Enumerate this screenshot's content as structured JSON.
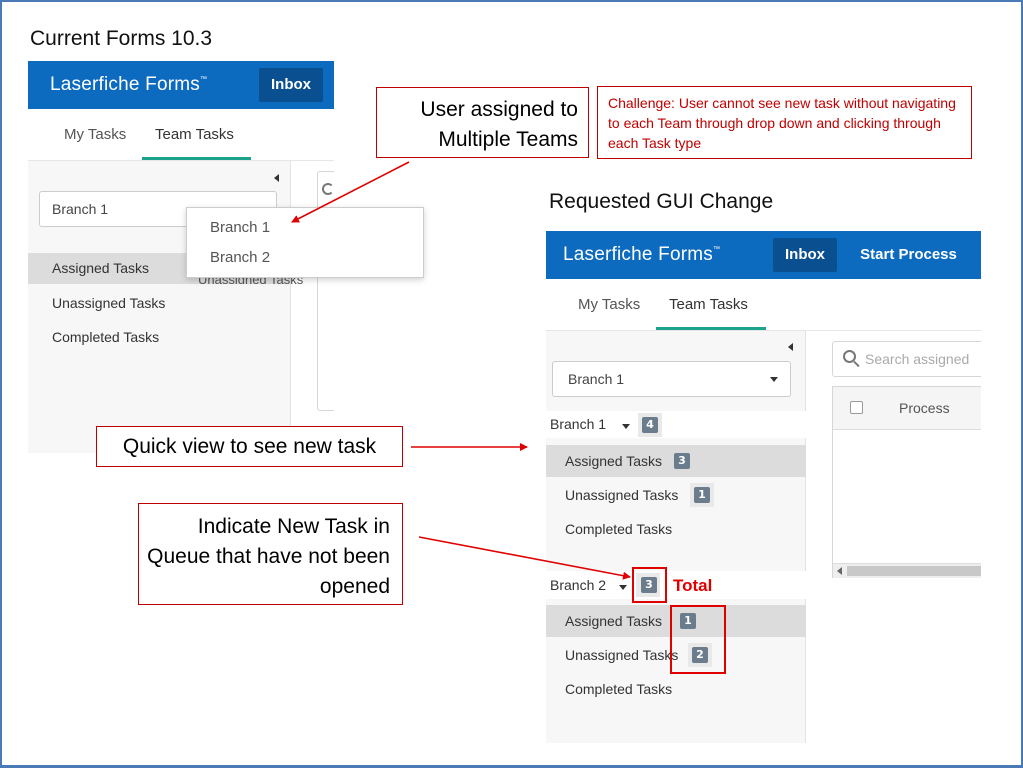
{
  "slide": {
    "current_title": "Current Forms 10.3",
    "requested_title": "Requested GUI Change"
  },
  "callouts": {
    "multiple_teams": "User assigned to Multiple Teams",
    "challenge": "Challenge: User cannot see new task without navigating to each Team through drop down and clicking through each Task type",
    "quick_view": "Quick view to see new task",
    "indicate_new": "Indicate New Task in Queue that have not been opened",
    "total_label": "Total"
  },
  "current_app": {
    "brand": "Laserfiche Forms",
    "trademark": "™",
    "inbox": "Inbox",
    "tabs": [
      "My Tasks",
      "Team Tasks"
    ],
    "team_select": "Branch 1",
    "dropdown_options": [
      "Branch 1",
      "Branch 2"
    ],
    "partial_hidden_text": "Unassigned Tasks",
    "nav": [
      "Assigned Tasks",
      "Unassigned Tasks",
      "Completed Tasks"
    ]
  },
  "requested_app": {
    "brand": "Laserfiche Forms",
    "trademark": "™",
    "inbox": "Inbox",
    "start_process": "Start Process",
    "tabs": [
      "My Tasks",
      "Team Tasks"
    ],
    "team_select": "Branch 1",
    "search_placeholder": "Search assigned",
    "table_header": "Process",
    "groups": [
      {
        "name": "Branch 1",
        "total": "4",
        "items": [
          {
            "label": "Assigned Tasks",
            "count": "3"
          },
          {
            "label": "Unassigned Tasks",
            "count": "1"
          },
          {
            "label": "Completed Tasks",
            "count": ""
          }
        ]
      },
      {
        "name": "Branch 2",
        "total": "3",
        "items": [
          {
            "label": "Assigned Tasks",
            "count": "1"
          },
          {
            "label": "Unassigned Tasks",
            "count": "2"
          },
          {
            "label": "Completed Tasks",
            "count": ""
          }
        ]
      }
    ]
  },
  "colors": {
    "brand_blue": "#0d6bbf",
    "inbox_dark": "#0a4f8f",
    "tab_accent": "#1aa38a",
    "callout_red": "#c00000",
    "badge": "#6b7c8c"
  }
}
